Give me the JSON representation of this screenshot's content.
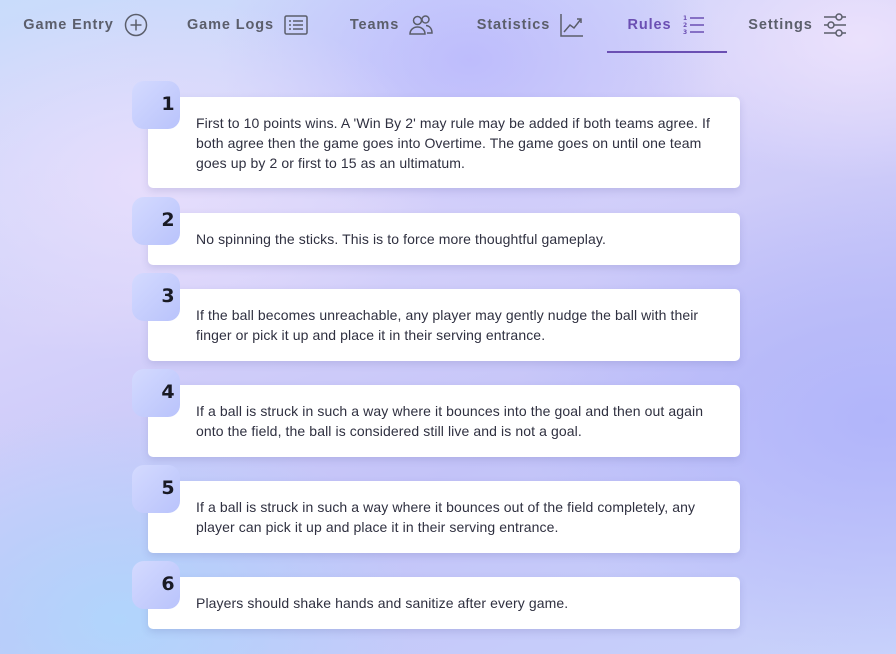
{
  "nav": {
    "tabs": [
      {
        "id": "entry",
        "label": "Game Entry",
        "icon": "plus-circle-icon"
      },
      {
        "id": "logs",
        "label": "Game Logs",
        "icon": "list-icon"
      },
      {
        "id": "teams",
        "label": "Teams",
        "icon": "users-icon"
      },
      {
        "id": "stats",
        "label": "Statistics",
        "icon": "chart-line-icon"
      },
      {
        "id": "rules",
        "label": "Rules",
        "icon": "ordered-list-icon"
      },
      {
        "id": "settings",
        "label": "Settings",
        "icon": "sliders-icon"
      }
    ],
    "active_tab": "Rules"
  },
  "colors": {
    "accent": "#6b4fb3",
    "tab_text": "#5b5e6b",
    "number_box": "#c4cdfc",
    "card": "#ffffff"
  },
  "rules": [
    {
      "number": "1",
      "text": "First to 10 points wins. A 'Win By 2' may rule may be added if both teams agree. If both agree then the game goes into Overtime. The game goes on until one team goes up by 2 or first to 15 as an ultimatum."
    },
    {
      "number": "2",
      "text": "No spinning the sticks. This is to force more thoughtful gameplay."
    },
    {
      "number": "3",
      "text": "If the ball becomes unreachable, any player may gently nudge the ball with their finger or pick it up and place it in their serving entrance."
    },
    {
      "number": "4",
      "text": "If a ball is struck in such a way where it bounces into the goal and then out again onto the field, the ball is considered still live and is not a goal."
    },
    {
      "number": "5",
      "text": "If a ball is struck in such a way where it bounces out of the field completely, any player can pick it up and place it in their serving entrance."
    },
    {
      "number": "6",
      "text": "Players should shake hands and sanitize after every game."
    }
  ]
}
